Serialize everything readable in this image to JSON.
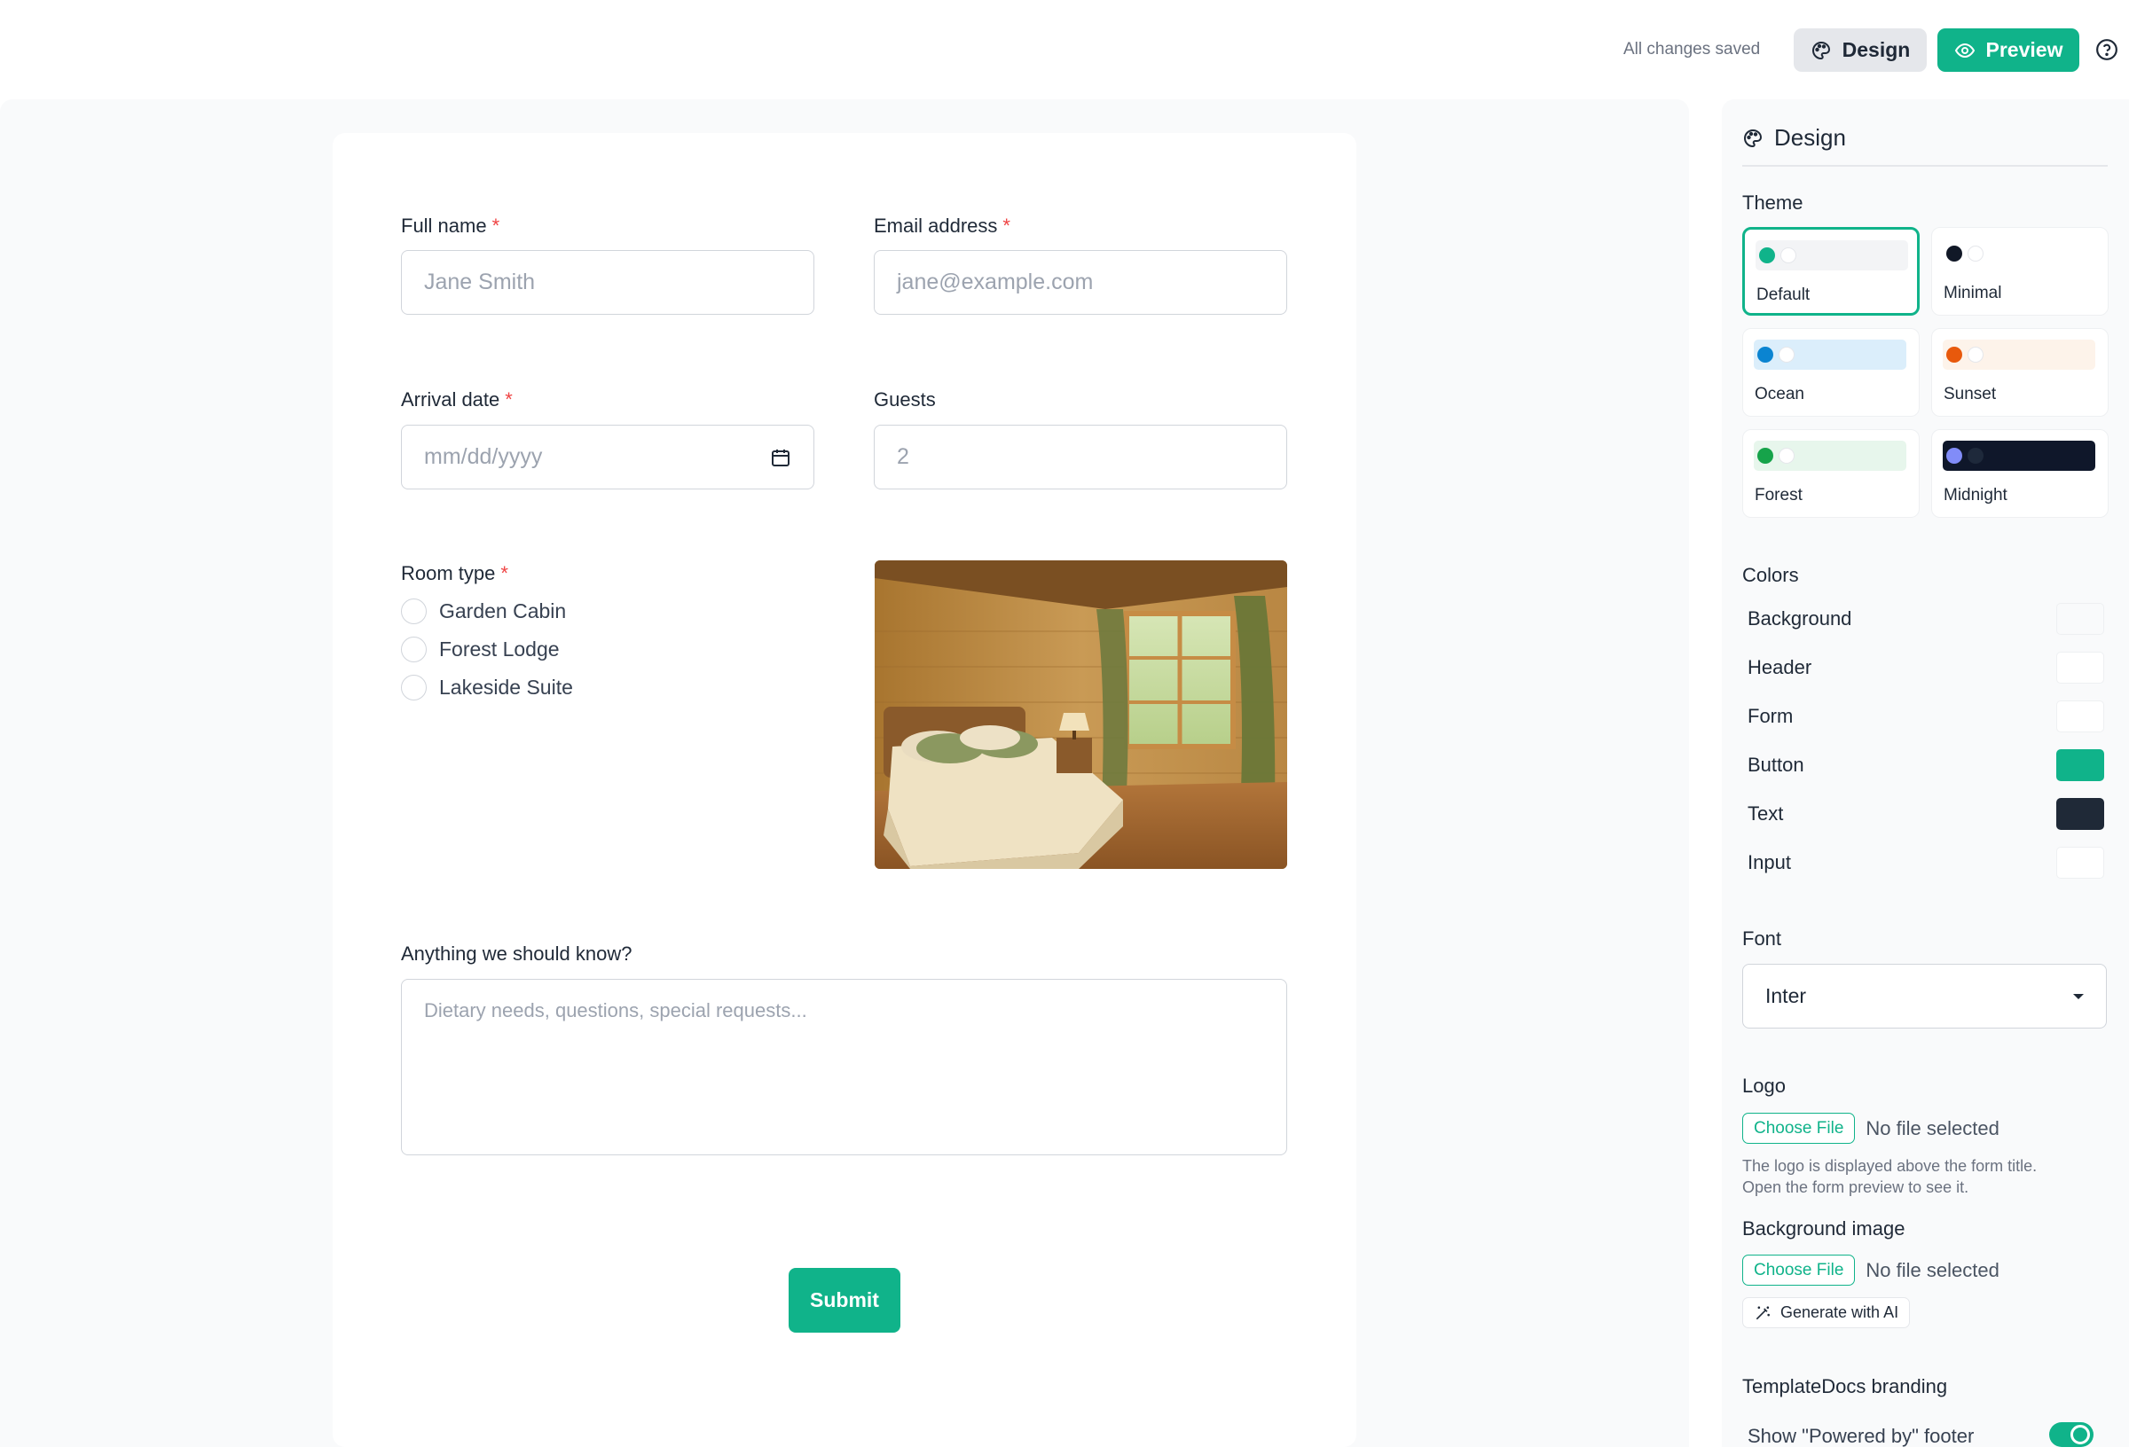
{
  "topbar": {
    "saved_status": "All changes saved",
    "design_label": "Design",
    "preview_label": "Preview"
  },
  "form": {
    "full_name": {
      "label": "Full name",
      "required": "*",
      "placeholder": "Jane Smith"
    },
    "email": {
      "label": "Email address",
      "required": "*",
      "placeholder": "jane@example.com"
    },
    "arrival": {
      "label": "Arrival date",
      "required": "*",
      "placeholder": "mm/dd/yyyy"
    },
    "guests": {
      "label": "Guests",
      "value": "2"
    },
    "room_type": {
      "label": "Room type",
      "required": "*",
      "options": [
        "Garden Cabin",
        "Forest Lodge",
        "Lakeside Suite"
      ]
    },
    "notes": {
      "label": "Anything we should know?",
      "placeholder": "Dietary needs, questions, special requests..."
    },
    "submit_label": "Submit"
  },
  "panel": {
    "title": "Design",
    "theme_label": "Theme",
    "themes": [
      {
        "name": "Default",
        "selected": true,
        "swatch": "#f3f4f6",
        "dot1": "#10b38a",
        "dot2": "#ffffff"
      },
      {
        "name": "Minimal",
        "selected": false,
        "swatch": "#ffffff",
        "dot1": "#111827",
        "dot2": "#ffffff"
      },
      {
        "name": "Ocean",
        "selected": false,
        "swatch": "#dbeefb",
        "dot1": "#0b84d1",
        "dot2": "#ffffff"
      },
      {
        "name": "Sunset",
        "selected": false,
        "swatch": "#fdf3ea",
        "dot1": "#e8590c",
        "dot2": "#ffffff"
      },
      {
        "name": "Forest",
        "selected": false,
        "swatch": "#e7f6ec",
        "dot1": "#16a34a",
        "dot2": "#ffffff"
      },
      {
        "name": "Midnight",
        "selected": false,
        "swatch": "#0f172a",
        "dot1": "#818cf8",
        "dot2": "#1e293b"
      }
    ],
    "colors_label": "Colors",
    "colors": [
      {
        "name": "Background",
        "value": "#f9fafb"
      },
      {
        "name": "Header",
        "value": "#ffffff"
      },
      {
        "name": "Form",
        "value": "#ffffff"
      },
      {
        "name": "Button",
        "value": "#10b38a"
      },
      {
        "name": "Text",
        "value": "#1f2937"
      },
      {
        "name": "Input",
        "value": "#ffffff"
      }
    ],
    "font_label": "Font",
    "font_value": "Inter",
    "logo_label": "Logo",
    "choose_file": "Choose File",
    "no_file": "No file selected",
    "logo_hint_1": "The logo is displayed above the form title.",
    "logo_hint_2": "Open the form preview to see it.",
    "bg_image_label": "Background image",
    "generate_ai": "Generate with AI",
    "branding_label": "TemplateDocs branding",
    "powered_by": "Show \"Powered by\" footer"
  },
  "colors": {
    "accent": "#10b38a",
    "required": "#ef4444"
  }
}
